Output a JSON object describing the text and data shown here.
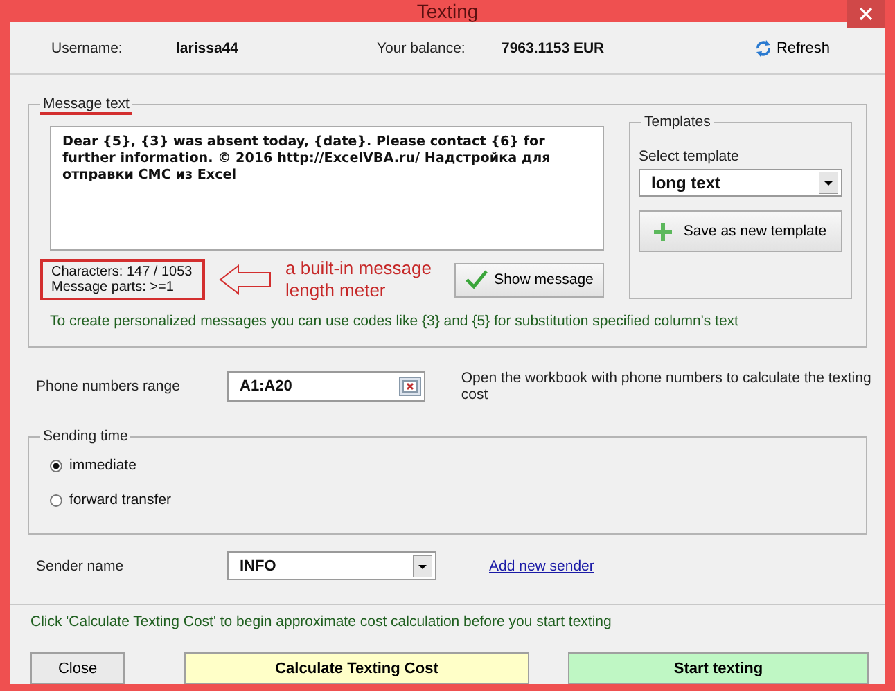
{
  "window": {
    "title": "Texting"
  },
  "header": {
    "username_label": "Username:",
    "username": "larissa44",
    "balance_label": "Your balance:",
    "balance": "7963.1153 EUR",
    "refresh": "Refresh"
  },
  "message": {
    "legend": "Message text",
    "text": "Dear {5}, {3} was absent today, {date}. Please contact {6} for further information. © 2016 http://ExcelVBA.ru/ Надстройка для отправки СМС из Excel",
    "characters": "Characters: 147 / 1053",
    "parts": "Message parts: >=1",
    "show_button": "Show message",
    "hint": "To create personalized messages you can use codes like {3} and {5} for substitution specified column's text"
  },
  "annotation": {
    "text": "a built-in message length meter"
  },
  "templates": {
    "legend": "Templates",
    "select_label": "Select template",
    "selected": "long text",
    "save_button": "Save as new template"
  },
  "phone": {
    "label": "Phone numbers range",
    "value": "A1:A20",
    "hint": "Open the workbook with phone numbers to calculate the texting cost"
  },
  "sending_time": {
    "legend": "Sending time",
    "options": [
      {
        "label": "immediate",
        "selected": true
      },
      {
        "label": "forward transfer",
        "selected": false
      }
    ]
  },
  "sender": {
    "label": "Sender name",
    "value": "INFO",
    "link": "Add new sender"
  },
  "footer": {
    "hint": "Click 'Calculate Texting Cost' to begin approximate cost calculation before you start texting",
    "buttons": [
      {
        "label": "Close",
        "kind": "plain"
      },
      {
        "label": "Calculate Texting Cost",
        "kind": "calculate"
      },
      {
        "label": "Start texting",
        "kind": "start"
      }
    ]
  }
}
